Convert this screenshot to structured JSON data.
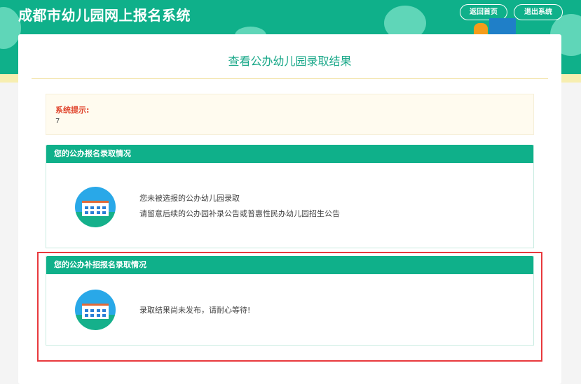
{
  "header": {
    "title": "成都市幼儿园网上报名系统",
    "home_button": "返回首页",
    "logout_button": "退出系统"
  },
  "page": {
    "title": "查看公办幼儿园录取结果"
  },
  "notice": {
    "label": "系统提示:",
    "value": "7"
  },
  "panels": [
    {
      "title": "您的公办报名录取情况",
      "lines": [
        "您未被选报的公办幼儿园录取",
        "请留意后续的公办园补录公告或普惠性民办幼儿园招生公告"
      ]
    },
    {
      "title": "您的公办补招报名录取情况",
      "lines": [
        "录取结果尚未发布，请耐心等待!"
      ]
    }
  ]
}
